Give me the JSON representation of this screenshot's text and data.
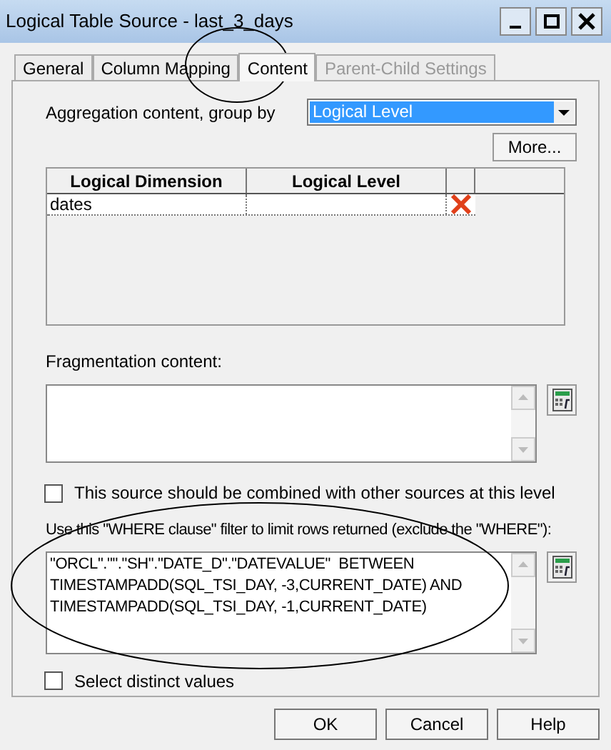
{
  "window": {
    "title": "Logical Table Source - last_3_days"
  },
  "tabs": [
    {
      "label": "General",
      "selected": false,
      "disabled": false
    },
    {
      "label": "Column Mapping",
      "selected": false,
      "disabled": false
    },
    {
      "label": "Content",
      "selected": true,
      "disabled": false
    },
    {
      "label": "Parent-Child Settings",
      "selected": false,
      "disabled": true
    }
  ],
  "aggregation": {
    "label": "Aggregation content, group by",
    "value": "Logical Level",
    "more_button": "More..."
  },
  "table": {
    "columns": [
      "Logical Dimension",
      "Logical Level"
    ],
    "rows": [
      {
        "cells": [
          "dates",
          ""
        ]
      }
    ]
  },
  "fragmentation": {
    "label": "Fragmentation content:"
  },
  "combine_checkbox": {
    "label": "This source should be combined with other sources at this level",
    "checked": false
  },
  "where": {
    "label": "Use this \"WHERE clause\" filter to limit rows returned (exclude the \"WHERE\"):",
    "value": "\"ORCL\".\"\".\"SH\".\"DATE_D\".\"DATEVALUE\"  BETWEEN\nTIMESTAMPADD(SQL_TSI_DAY, -3,CURRENT_DATE) AND\nTIMESTAMPADD(SQL_TSI_DAY, -1,CURRENT_DATE)"
  },
  "distinct_checkbox": {
    "label": "Select distinct values",
    "checked": false
  },
  "buttons": [
    "OK",
    "Cancel",
    "Help"
  ]
}
